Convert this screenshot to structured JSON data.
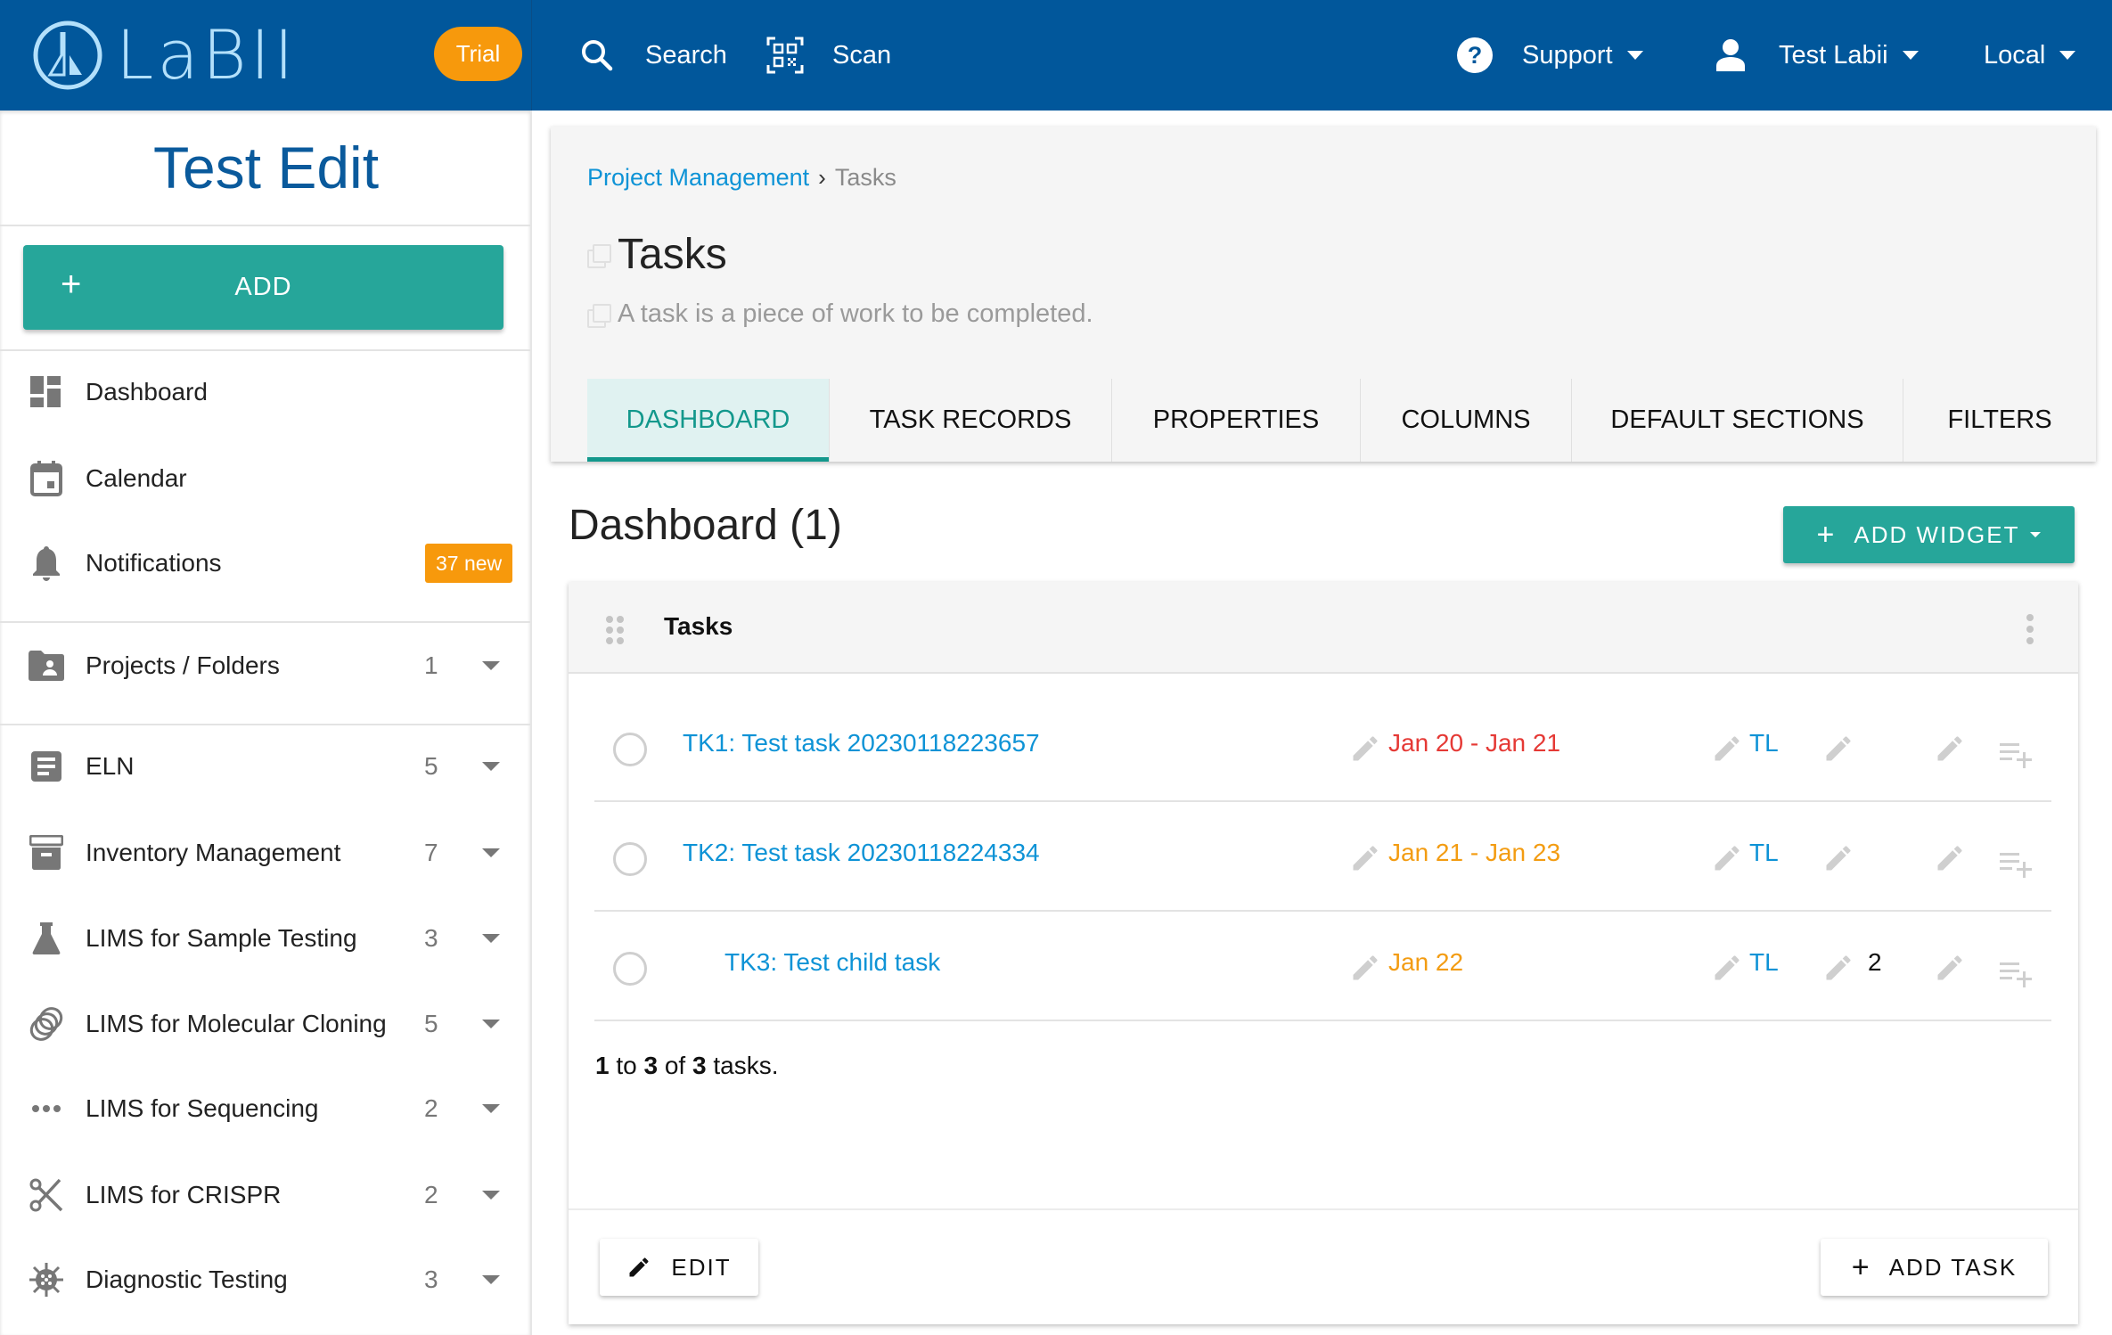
{
  "header": {
    "logo_text": "LaBII",
    "trial_badge": "Trial",
    "search_label": "Search",
    "scan_label": "Scan",
    "support_label": "Support",
    "user_label": "Test Labii",
    "location_label": "Local",
    "colors": {
      "bar": "#01579b",
      "logo": "#b3e0fb",
      "trial": "#f7990c"
    }
  },
  "sidebar": {
    "project_title": "Test Edit",
    "add_label": "ADD",
    "items": [
      {
        "label": "Dashboard",
        "icon": "dashboard-icon"
      },
      {
        "label": "Calendar",
        "icon": "calendar-icon"
      },
      {
        "label": "Notifications",
        "icon": "bell-icon",
        "badge": "37 new"
      },
      {
        "label": "Projects / Folders",
        "icon": "folder-shared-icon",
        "count": "1"
      },
      {
        "label": "ELN",
        "icon": "notes-icon",
        "count": "5"
      },
      {
        "label": "Inventory Management",
        "icon": "archive-icon",
        "count": "7"
      },
      {
        "label": "LIMS for Sample Testing",
        "icon": "flask-icon",
        "count": "3"
      },
      {
        "label": "LIMS for Molecular Cloning",
        "icon": "rings-icon",
        "count": "5"
      },
      {
        "label": "LIMS for Sequencing",
        "icon": "dots-icon",
        "count": "2"
      },
      {
        "label": "LIMS for CRISPR",
        "icon": "scissors-icon",
        "count": "2"
      },
      {
        "label": "Diagnostic Testing",
        "icon": "virus-icon",
        "count": "3"
      }
    ]
  },
  "main": {
    "breadcrumb": {
      "parent": "Project Management",
      "separator": "›",
      "current": "Tasks"
    },
    "title": "Tasks",
    "description": "A task is a piece of work to be completed.",
    "tabs": [
      {
        "label": "DASHBOARD",
        "active": true
      },
      {
        "label": "TASK RECORDS",
        "active": false
      },
      {
        "label": "PROPERTIES",
        "active": false
      },
      {
        "label": "COLUMNS",
        "active": false
      },
      {
        "label": "DEFAULT SECTIONS",
        "active": false
      },
      {
        "label": "FILTERS",
        "active": false
      }
    ],
    "dashboard_title": "Dashboard (1)",
    "add_widget_label": "ADD WIDGET"
  },
  "widget": {
    "title": "Tasks",
    "tasks": [
      {
        "name": "TK1: Test task 20230118223657",
        "date": "Jan 20 - Jan 21",
        "date_color": "#e53935",
        "assignee": "TL",
        "subtask_count": "",
        "child": false
      },
      {
        "name": "TK2: Test task 20230118224334",
        "date": "Jan 21 - Jan 23",
        "date_color": "#f39c12",
        "assignee": "TL",
        "subtask_count": "",
        "child": false
      },
      {
        "name": "TK3: Test child task",
        "date": "Jan 22",
        "date_color": "#f39c12",
        "assignee": "TL",
        "subtask_count": "2",
        "child": true
      }
    ],
    "summary": {
      "from": "1",
      "to_word": "to",
      "to": "3",
      "of_word": "of",
      "total": "3",
      "suffix": "tasks."
    },
    "edit_label": "EDIT",
    "add_task_label": "ADD TASK"
  }
}
